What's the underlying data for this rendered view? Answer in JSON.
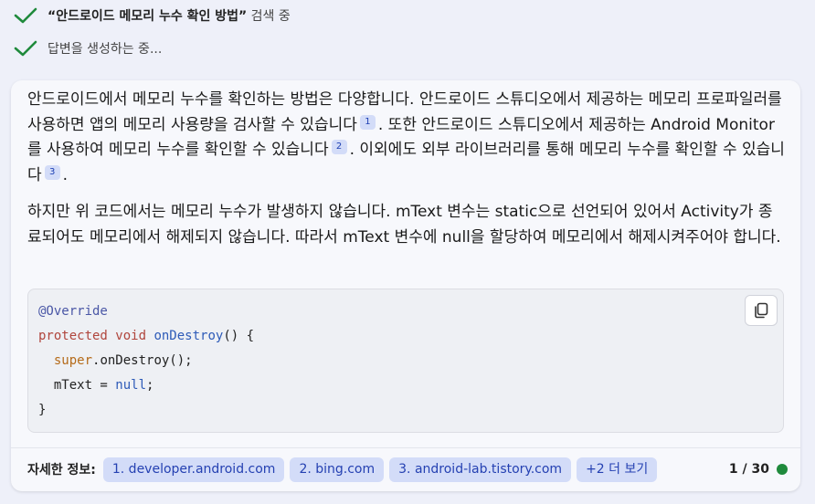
{
  "status": {
    "search_query": "“안드로이드 메모리 누수 확인 방법”",
    "search_suffix": " 검색 중",
    "generating": "답변을 생성하는 중..."
  },
  "answer": {
    "p1_s1": "안드로이드에서 메모리 누수를 확인하는 방법은 다양합니다. 안드로이드 스튜디오에서 제공하는 메모리 프로파일러를 사용하면 앱의 메모리 사용량을 검사할 수 있습니다",
    "p1_ref1": "1",
    "p1_s2": ". 또한 안드로이드 스튜디오에서 제공하는 Android Monitor를 사용하여 메모리 누수를 확인할 수 있습니다",
    "p1_ref2": "2",
    "p1_s3": ". 이외에도 외부 라이브러리를 통해 메모리 누수를 확인할 수 있습니다",
    "p1_ref3": "3",
    "p1_end": ".",
    "p2": "하지만 위 코드에서는 메모리 누수가 발생하지 않습니다. mText 변수는 static으로 선언되어 있어서 Activity가 종료되어도 메모리에서 해제되지 않습니다. 따라서 mText 변수에 null을 할당하여 메모리에서 해제시켜주어야 합니다."
  },
  "code": {
    "annotation": "@Override",
    "kw_protected": "protected",
    "kw_void": "void",
    "method_name": "onDestroy",
    "sig_tail": "() {",
    "kw_super": "super",
    "super_call": ".onDestroy();",
    "assign_lhs": "mText = ",
    "kw_null": "null",
    "semicolon": ";",
    "close_brace": "}"
  },
  "footer": {
    "label": "자세한 정보:",
    "links": [
      "1. developer.android.com",
      "2. bing.com",
      "3. android-lab.tistory.com"
    ],
    "more": "+2 더 보기",
    "counter": "1 / 30"
  },
  "colors": {
    "check": "#1f8a3c",
    "chip_bg": "#d3dcf8",
    "chip_text": "#2541b2",
    "status_dot": "#1f8a3c"
  }
}
